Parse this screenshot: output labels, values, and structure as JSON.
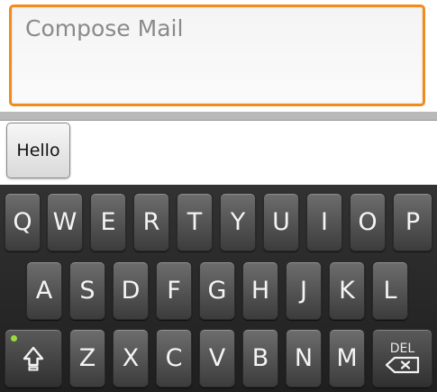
{
  "compose": {
    "placeholder": "Compose Mail"
  },
  "suggestions": [
    {
      "label": "Hello"
    }
  ],
  "keyboard": {
    "row1": [
      "Q",
      "W",
      "E",
      "R",
      "T",
      "Y",
      "U",
      "I",
      "O",
      "P"
    ],
    "row2": [
      "A",
      "S",
      "D",
      "F",
      "G",
      "H",
      "J",
      "K",
      "L"
    ],
    "row3": [
      "Z",
      "X",
      "C",
      "V",
      "B",
      "N",
      "M"
    ],
    "shift_icon": "shift-arrow-icon",
    "delete_label": "DEL",
    "delete_icon": "backspace-icon",
    "shift_indicator_color": "#9bdc38"
  },
  "colors": {
    "focus_border": "#f08c1e",
    "keyboard_bg": "#262626"
  }
}
